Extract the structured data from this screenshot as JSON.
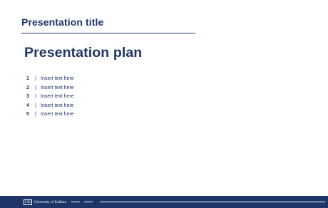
{
  "slide": {
    "header_title": "Presentation title",
    "section_heading": "Presentation plan",
    "agenda": [
      {
        "number": "1",
        "separator": "|",
        "text": "Insert text here"
      },
      {
        "number": "2",
        "separator": "|",
        "text": "Insert text here"
      },
      {
        "number": "3",
        "separator": "|",
        "text": "Insert text here"
      },
      {
        "number": "4",
        "separator": "|",
        "text": "Insert text here"
      },
      {
        "number": "5",
        "separator": "|",
        "text": "Insert text here"
      }
    ]
  },
  "footer": {
    "logo_mark": "UK",
    "logo_text": "University of Kallista"
  },
  "colors": {
    "brand_navy": "#1f3567",
    "background": "#ffffff"
  }
}
